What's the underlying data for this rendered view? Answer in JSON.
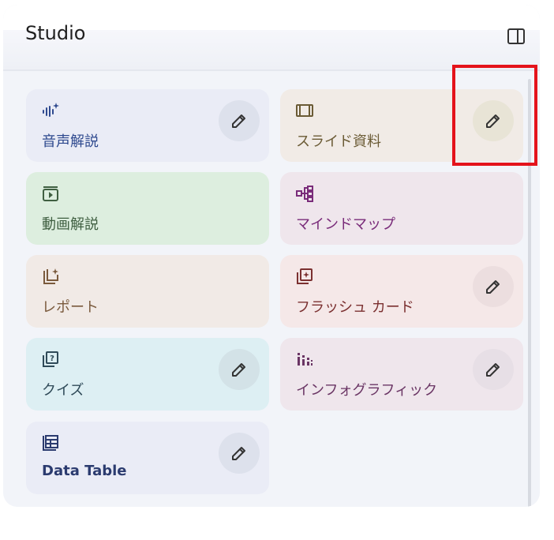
{
  "panel": {
    "title": "Studio",
    "toggle_icon": "sidebar-panel-icon"
  },
  "tiles": [
    {
      "label": "音声解説",
      "icon": "audio-sparkle-icon",
      "color": "#2f4a8f",
      "has_edit": true
    },
    {
      "label": "スライド資料",
      "icon": "slides-icon",
      "color": "#6b5b35",
      "has_edit": true
    },
    {
      "label": "動画解説",
      "icon": "video-icon",
      "color": "#3f5f41",
      "has_edit": false
    },
    {
      "label": "マインドマップ",
      "icon": "mindmap-icon",
      "color": "#7a2c7a",
      "has_edit": false
    },
    {
      "label": "レポート",
      "icon": "report-icon",
      "color": "#7a5a3d",
      "has_edit": false
    },
    {
      "label": "フラッシュ カード",
      "icon": "flashcard-icon",
      "color": "#7b3030",
      "has_edit": true
    },
    {
      "label": "クイズ",
      "icon": "quiz-icon",
      "color": "#2f4a58",
      "has_edit": true
    },
    {
      "label": "インフォグラフィック",
      "icon": "infographic-icon",
      "color": "#6a3564",
      "has_edit": true
    },
    {
      "label": "Data Table",
      "icon": "table-icon",
      "color": "#2b3b6f",
      "has_edit": true
    }
  ],
  "highlight": {
    "color": "#e4131b",
    "target": "スライド資料 edit button"
  }
}
